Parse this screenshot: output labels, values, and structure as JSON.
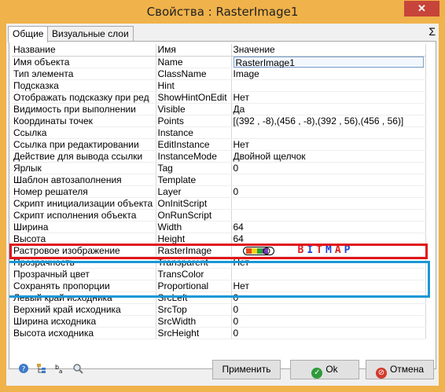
{
  "window": {
    "title": "Свойства : RasterImage1",
    "close_label": "✕"
  },
  "tabs": [
    {
      "label": "Общие"
    },
    {
      "label": "Визуальные слои"
    }
  ],
  "sigma_label": "Σ",
  "table": {
    "headers": [
      "Название",
      "Имя",
      "Значение"
    ],
    "rows": [
      {
        "name": "Имя объекта",
        "id": "Name",
        "value": "RasterImage1"
      },
      {
        "name": "Тип элемента",
        "id": "ClassName",
        "value": "Image"
      },
      {
        "name": "Подсказка",
        "id": "Hint",
        "value": ""
      },
      {
        "name": "Отображать подсказку при ред",
        "id": "ShowHintOnEdit",
        "value": "Нет"
      },
      {
        "name": "Видимость при выполнении",
        "id": "Visible",
        "value": "Да"
      },
      {
        "name": "Координаты точек",
        "id": "Points",
        "value": "[(392 , -8),(456 , -8),(392 , 56),(456 , 56)]"
      },
      {
        "name": "Ссылка",
        "id": "Instance",
        "value": ""
      },
      {
        "name": "Ссылка при редактировании",
        "id": "EditInstance",
        "value": "Нет"
      },
      {
        "name": "Действие для вывода ссылки",
        "id": "InstanceMode",
        "value": "Двойной щелчок"
      },
      {
        "name": "Ярлык",
        "id": "Tag",
        "value": "0"
      },
      {
        "name": "Шаблон автозаполнения",
        "id": "Template",
        "value": ""
      },
      {
        "name": "Номер решателя",
        "id": "Layer",
        "value": "0"
      },
      {
        "name": "Скрипт инициализации объекта",
        "id": "OnInitScript",
        "value": ""
      },
      {
        "name": "Скрипт исполнения объекта",
        "id": "OnRunScript",
        "value": ""
      },
      {
        "name": "Ширина",
        "id": "Width",
        "value": "64"
      },
      {
        "name": "Высота",
        "id": "Height",
        "value": "64"
      },
      {
        "name": "Растровое изображение",
        "id": "RasterImage",
        "value": "BITMAP"
      },
      {
        "name": "Прозрачность",
        "id": "Transparent",
        "value": "Нет"
      },
      {
        "name": "Прозрачный цвет",
        "id": "TransColor",
        "value": ""
      },
      {
        "name": "Сохранять пропорции",
        "id": "Proportional",
        "value": "Нет"
      },
      {
        "name": "Левый край исходника",
        "id": "SrcLeft",
        "value": "0"
      },
      {
        "name": "Верхний край исходника",
        "id": "SrcTop",
        "value": "0"
      },
      {
        "name": "Ширина исходника",
        "id": "SrcWidth",
        "value": "0"
      },
      {
        "name": "Высота исходника",
        "id": "SrcHeight",
        "value": "0"
      }
    ]
  },
  "buttons": {
    "apply": "Применить",
    "ok": "Ok",
    "cancel": "Отмена"
  },
  "icons": [
    "help-icon",
    "tree-icon",
    "sort-icon",
    "search-icon"
  ],
  "colors": {
    "frame": "#f0b24a",
    "highlight_red": "#e0151b",
    "highlight_blue": "#1b97d6"
  }
}
